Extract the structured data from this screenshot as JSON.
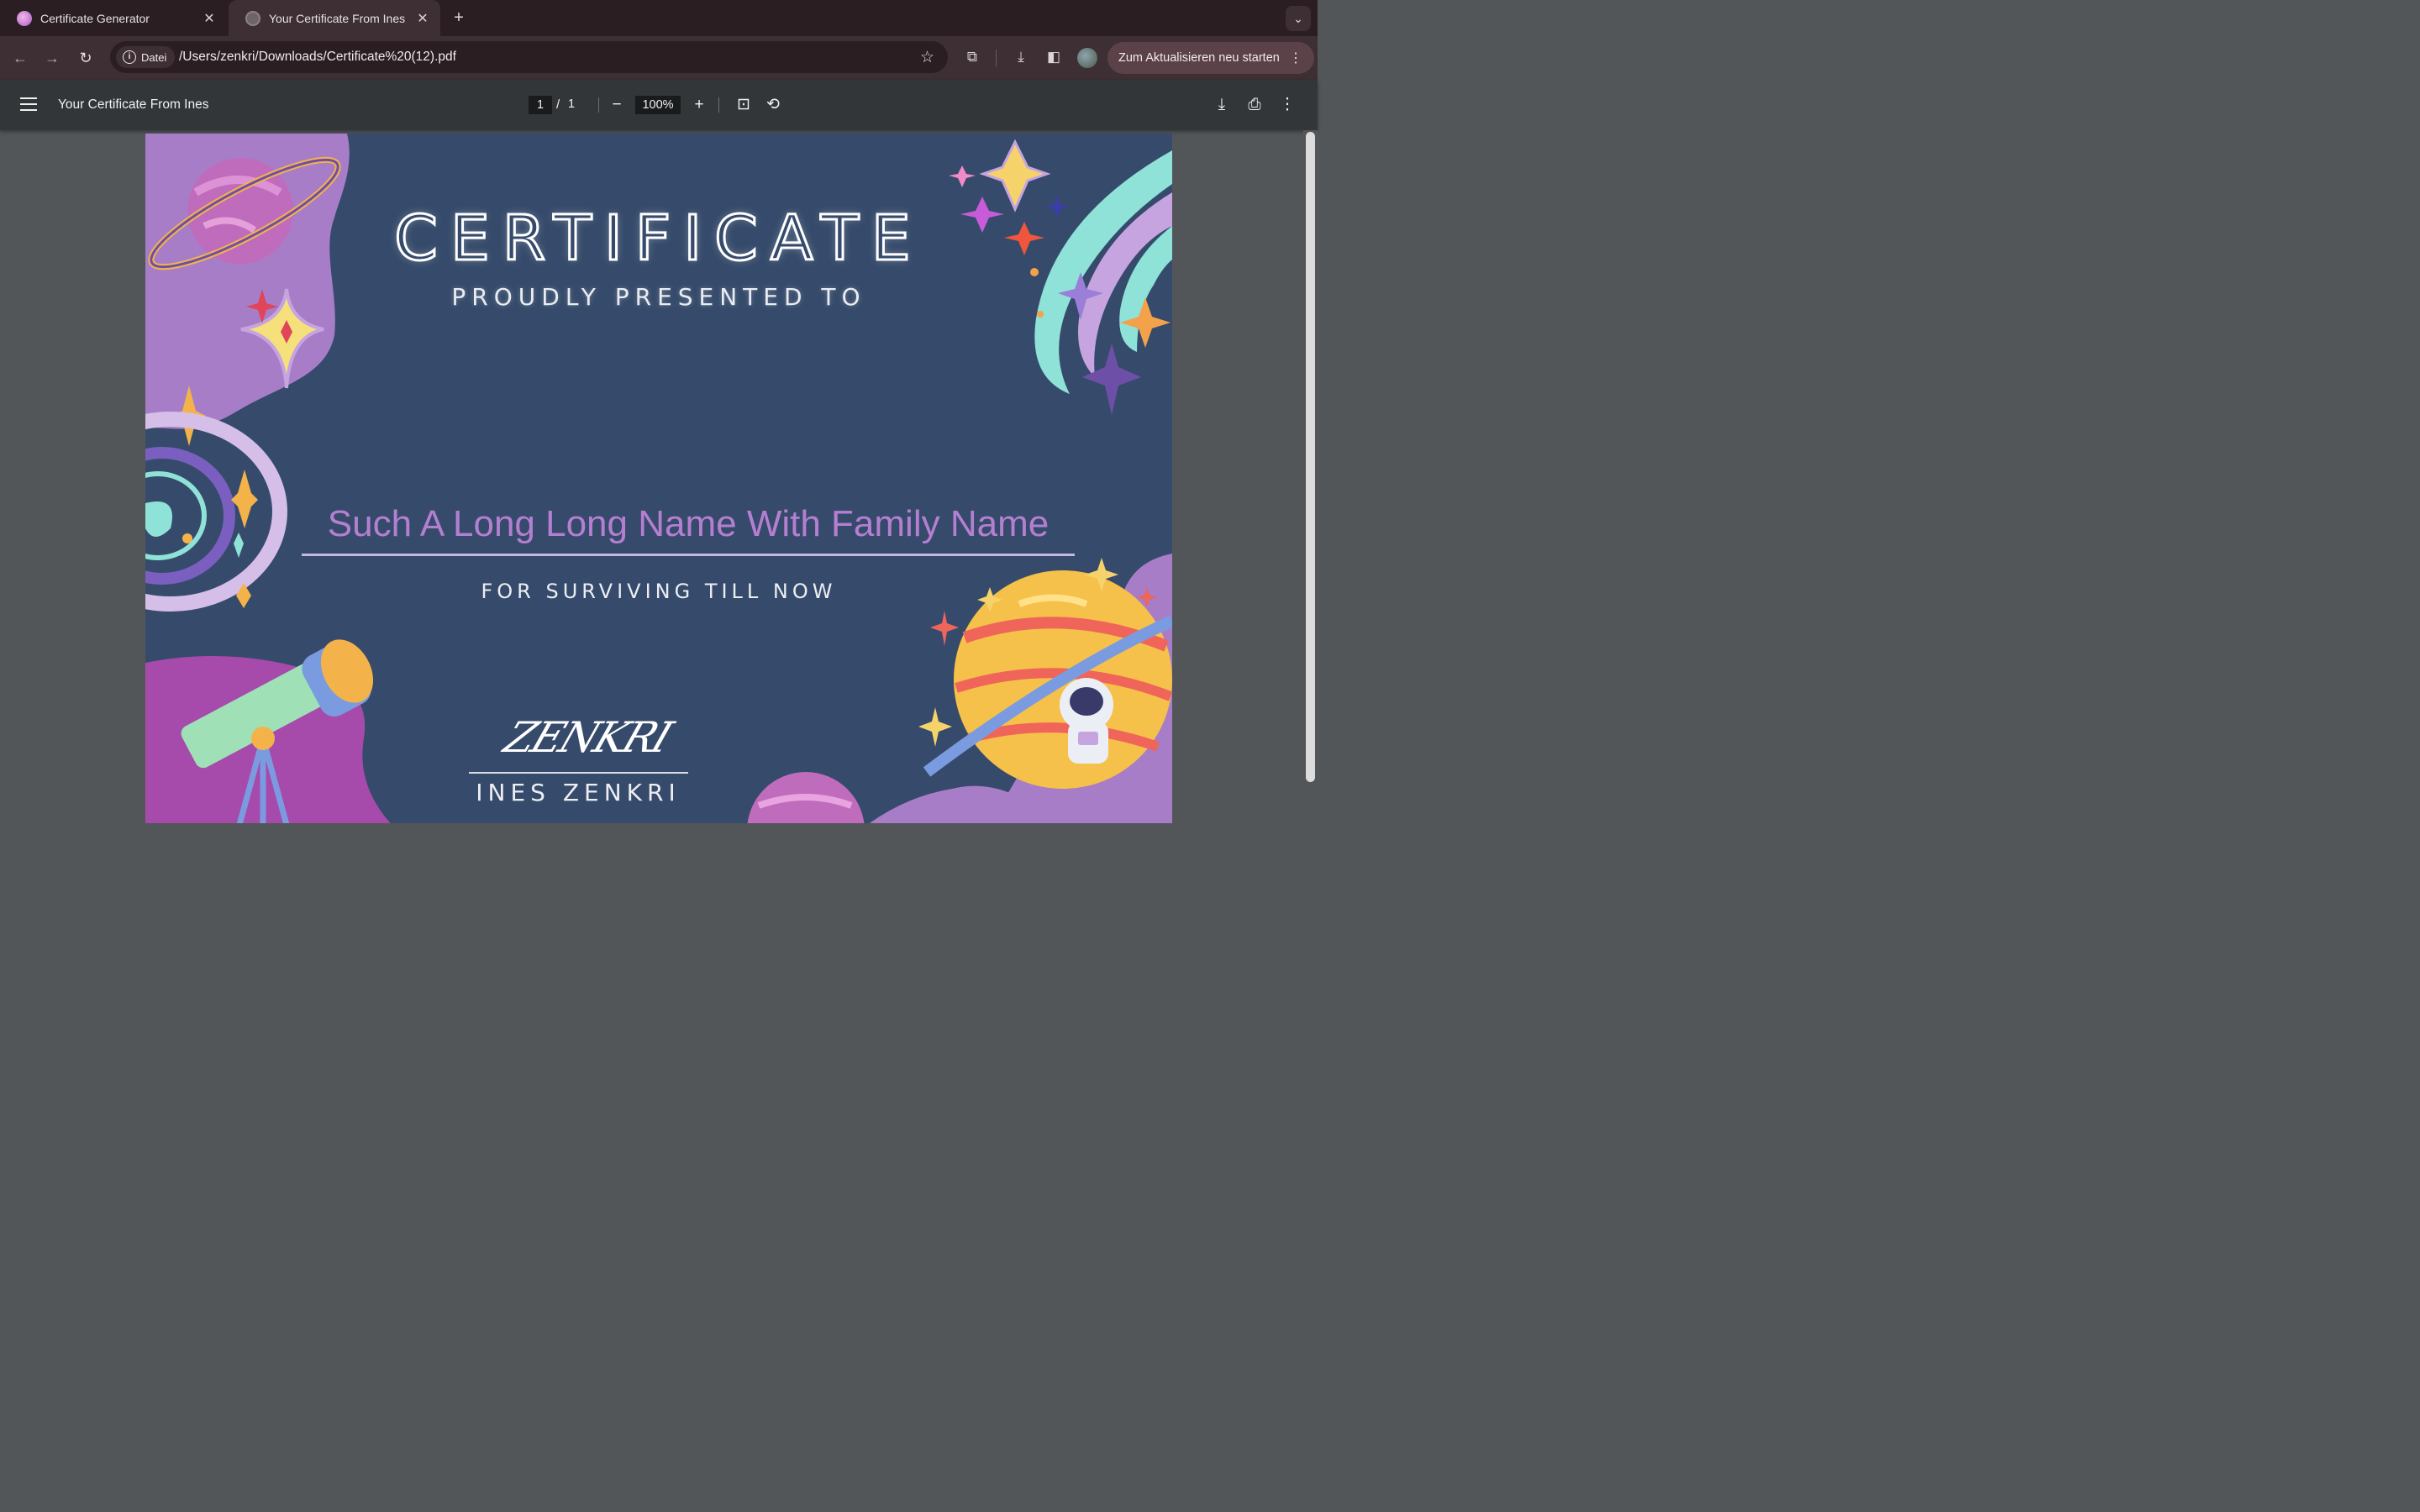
{
  "tabs": [
    {
      "title": "Certificate Generator",
      "active": false
    },
    {
      "title": "Your Certificate From Ines",
      "active": true
    }
  ],
  "omnibox": {
    "chip_label": "Datei",
    "url": "/Users/zenkri/Downloads/Certificate%20(12).pdf"
  },
  "update_button": {
    "label": "Zum Aktualisieren neu starten"
  },
  "pdf_viewer": {
    "title": "Your Certificate From Ines",
    "current_page": "1",
    "page_separator": "/",
    "total_pages": "1",
    "zoom": "100%"
  },
  "certificate": {
    "title": "CERTIFICATE",
    "subtitle": "PROUDLY PRESENTED TO",
    "recipient": "Such A Long Long Name With Family Name",
    "reason": "FOR SURVIVING TILL NOW",
    "signature": "ZENKRI",
    "signer_name": "INES ZENKRI"
  },
  "colors": {
    "certificate_background": "#364b6b",
    "recipient_text": "#b57fd1",
    "tab_strip": "#2a1e22",
    "toolbar": "#3d2f33",
    "pdf_toolbar": "#323639",
    "viewer_background": "#525659"
  }
}
